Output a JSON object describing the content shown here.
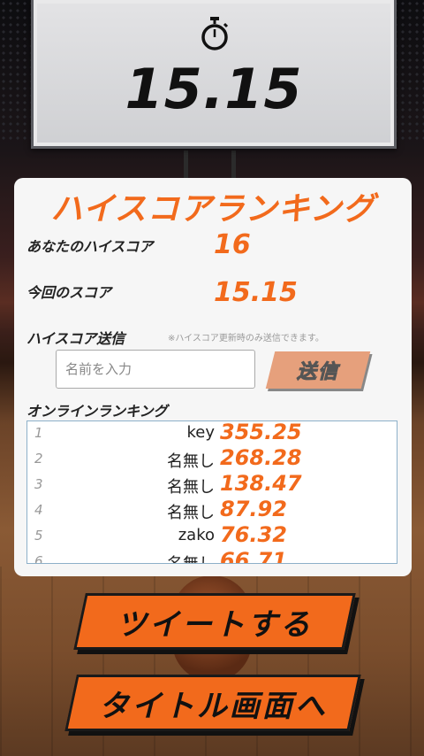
{
  "scoreboard": {
    "time": "15.15",
    "icon": "stopwatch-icon"
  },
  "panel": {
    "title": "ハイスコアランキング",
    "your_highscore_label": "あなたのハイスコア",
    "your_highscore_value": "16",
    "this_score_label": "今回のスコア",
    "this_score_value": "15.15",
    "send_label": "ハイスコア送信",
    "send_note": "※ハイスコア更新時のみ送信できます。",
    "name_placeholder": "名前を入力",
    "send_button": "送信",
    "ranking_label": "オンラインランキング",
    "ranking": [
      {
        "rank": "1",
        "name": "key",
        "score": "355.25"
      },
      {
        "rank": "2",
        "name": "名無し",
        "score": "268.28"
      },
      {
        "rank": "3",
        "name": "名無し",
        "score": "138.47"
      },
      {
        "rank": "4",
        "name": "名無し",
        "score": "87.92"
      },
      {
        "rank": "5",
        "name": "zako",
        "score": "76.32"
      },
      {
        "rank": "6",
        "name": "名無し",
        "score": "66.71"
      }
    ]
  },
  "buttons": {
    "tweet": "ツイートする",
    "to_title": "タイトル画面へ"
  },
  "colors": {
    "accent": "#f26a1c",
    "send_button": "#e6a07c"
  }
}
